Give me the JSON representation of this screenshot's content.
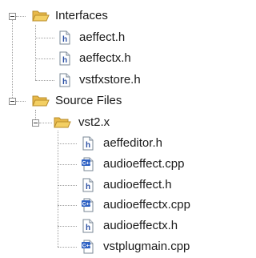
{
  "tree": {
    "interfaces": {
      "label": "Interfaces",
      "expanded": true,
      "items": [
        {
          "label": "aeffect.h",
          "type": "header"
        },
        {
          "label": "aeffectx.h",
          "type": "header"
        },
        {
          "label": "vstfxstore.h",
          "type": "header"
        }
      ]
    },
    "source_files": {
      "label": "Source Files",
      "expanded": true,
      "subfolder": {
        "label": "vst2.x",
        "expanded": true,
        "items": [
          {
            "label": "aeffeditor.h",
            "type": "header"
          },
          {
            "label": "audioeffect.cpp",
            "type": "cpp"
          },
          {
            "label": "audioeffect.h",
            "type": "header"
          },
          {
            "label": "audioeffectx.cpp",
            "type": "cpp"
          },
          {
            "label": "audioeffectx.h",
            "type": "header"
          },
          {
            "label": "vstplugmain.cpp",
            "type": "cpp"
          }
        ]
      }
    }
  },
  "icons": {
    "folder": "folder-open-icon",
    "header": "header-file-icon",
    "cpp": "cpp-file-icon",
    "header_badge": "h",
    "cpp_badge": "C++"
  },
  "colors": {
    "folder_fill": "#f3cf63",
    "folder_stroke": "#b98d2a",
    "header_letter": "#2b4fa3",
    "cpp_badge": "#2f62c4",
    "tree_line": "#a0a0a0"
  }
}
